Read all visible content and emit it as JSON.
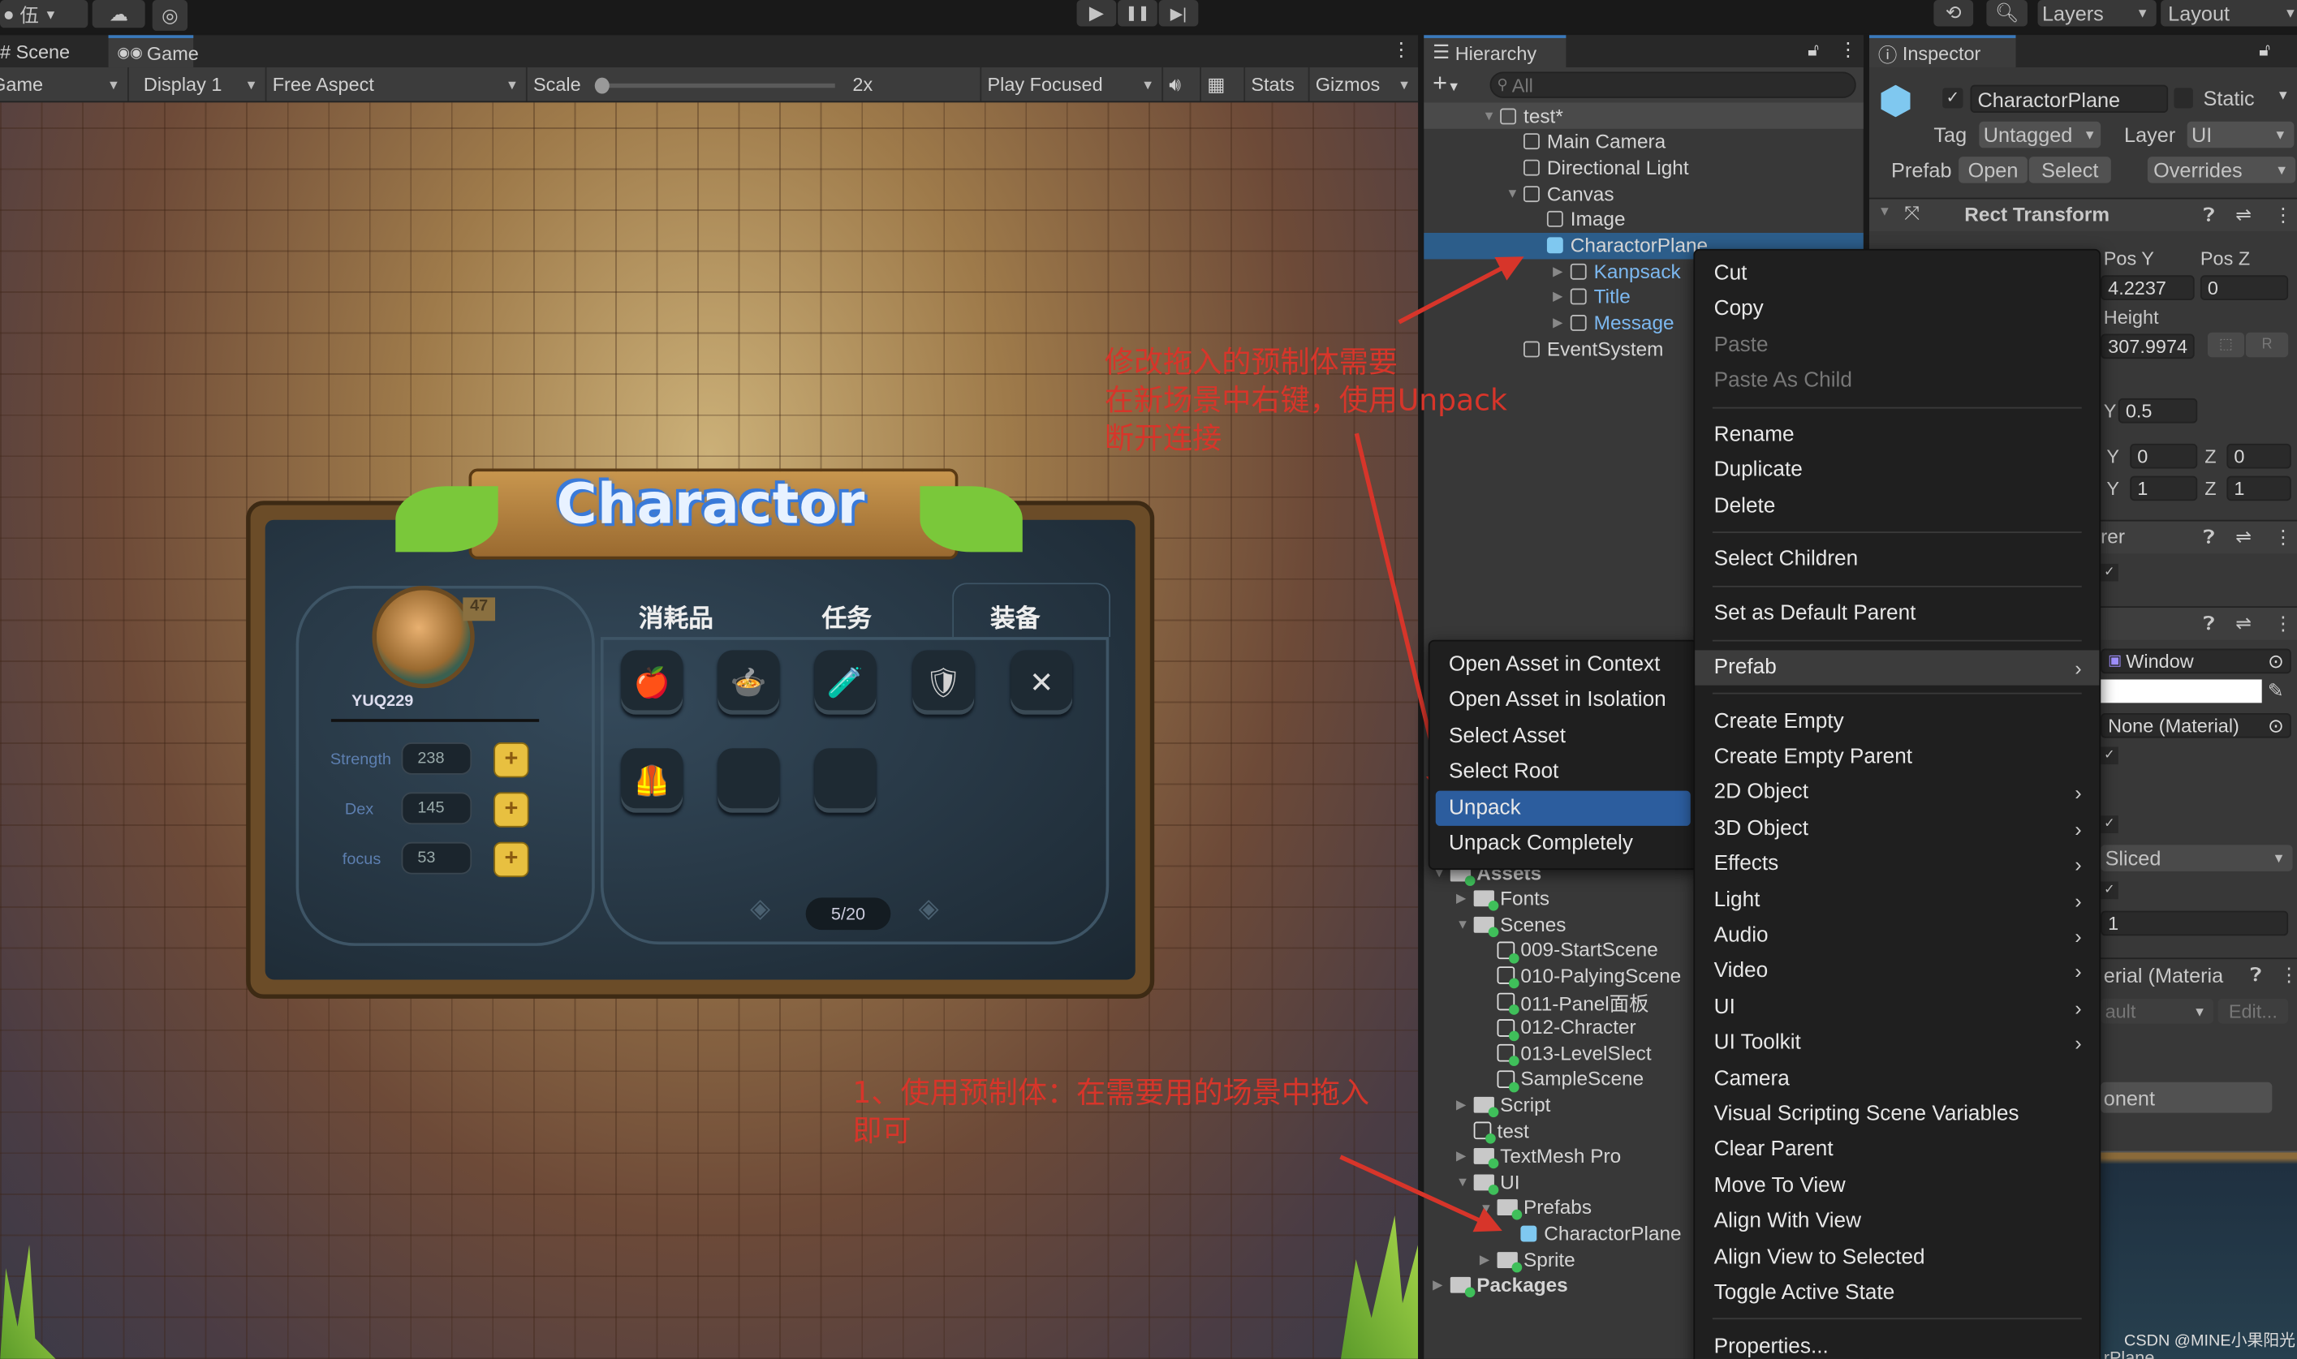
{
  "toolbar": {
    "account": "伍",
    "play": "▶",
    "pause": "❚❚",
    "step": "▶|",
    "layers": "Layers",
    "layout": "Layout"
  },
  "game_panel": {
    "tabs": [
      "Scene",
      "Game"
    ],
    "active_tab": "Game",
    "controls": {
      "mode": "Game",
      "display": "Display 1",
      "aspect": "Free Aspect",
      "scale_label": "Scale",
      "scale_value": "2x",
      "scale_fraction": 0.0,
      "play_mode": "Play Focused",
      "stats": "Stats",
      "gizmos": "Gizmos"
    }
  },
  "game_ui": {
    "title": "Charactor",
    "player_name": "YUQ229",
    "level": "47",
    "stats": [
      {
        "label": "Strength",
        "value": "238"
      },
      {
        "label": "Dex",
        "value": "145"
      },
      {
        "label": "focus",
        "value": "53"
      }
    ],
    "tabs": [
      "消耗品",
      "任务",
      "装备"
    ],
    "active_tab": "装备",
    "items": [
      "🍎",
      "🍲",
      "🧪",
      "🛡",
      "✕",
      "🦺",
      "",
      ""
    ],
    "page": "5/20"
  },
  "hierarchy": {
    "tab": "Hierarchy",
    "search_placeholder": "All",
    "items": [
      {
        "label": "test*",
        "depth": 0,
        "expanded": true
      },
      {
        "label": "Main Camera",
        "depth": 1
      },
      {
        "label": "Directional Light",
        "depth": 1
      },
      {
        "label": "Canvas",
        "depth": 1,
        "expanded": true
      },
      {
        "label": "Image",
        "depth": 2
      },
      {
        "label": "CharactorPlane",
        "depth": 2,
        "selected": true,
        "prefab": true
      },
      {
        "label": "Kanpsack",
        "depth": 3,
        "prefab_child": true
      },
      {
        "label": "Title",
        "depth": 3,
        "prefab_child": true
      },
      {
        "label": "Message",
        "depth": 3,
        "prefab_child": true
      },
      {
        "label": "EventSystem",
        "depth": 1
      }
    ]
  },
  "project": {
    "items": [
      {
        "label": "Assets",
        "type": "folder",
        "depth": 0
      },
      {
        "label": "Fonts",
        "type": "folder",
        "depth": 1
      },
      {
        "label": "Scenes",
        "type": "folder",
        "depth": 1
      },
      {
        "label": "009-StartScene",
        "type": "scene",
        "depth": 2
      },
      {
        "label": "010-PalyingScene",
        "type": "scene",
        "depth": 2
      },
      {
        "label": "011-Panel面板",
        "type": "scene",
        "depth": 2
      },
      {
        "label": "012-Chracter",
        "type": "scene",
        "depth": 2
      },
      {
        "label": "013-LevelSlect",
        "type": "scene",
        "depth": 2
      },
      {
        "label": "SampleScene",
        "type": "scene",
        "depth": 2
      },
      {
        "label": "Script",
        "type": "folder",
        "depth": 1
      },
      {
        "label": "test",
        "type": "scene",
        "depth": 1
      },
      {
        "label": "TextMesh Pro",
        "type": "folder",
        "depth": 1
      },
      {
        "label": "UI",
        "type": "folder",
        "depth": 1
      },
      {
        "label": "Prefabs",
        "type": "folder",
        "depth": 2
      },
      {
        "label": "CharactorPlane",
        "type": "prefab",
        "depth": 3
      },
      {
        "label": "Sprite",
        "type": "folder",
        "depth": 2
      },
      {
        "label": "Packages",
        "type": "folder",
        "depth": 0
      }
    ]
  },
  "inspector": {
    "tab": "Inspector",
    "object_name": "CharactorPlane",
    "active": true,
    "static_label": "Static",
    "tag_label": "Tag",
    "tag": "Untagged",
    "layer_label": "Layer",
    "layer": "UI",
    "prefab_label": "Prefab",
    "open": "Open",
    "select": "Select",
    "overrides": "Overrides",
    "rect_transform": "Rect Transform",
    "pos_y_label": "Pos Y",
    "pos_z_label": "Pos Z",
    "pos_y": "4.2237",
    "pos_z": "0",
    "height_label": "Height",
    "height": "307.9974",
    "r_label": "R",
    "pivot_y_label": "Y",
    "pivot_y": "0.5",
    "rot_y_label": "Y",
    "rot_y": "0",
    "rot_z_label": "Z",
    "rot_z": "0",
    "scale_y_label": "Y",
    "scale_y": "1",
    "scale_z_label": "Z",
    "scale_z": "1",
    "renderer_fragment": "rer",
    "source_image": "Window",
    "material": "None (Material)",
    "image_type": "Sliced",
    "pixels_per_unit": "1",
    "material_section": "erial (Materia",
    "shader": "ault",
    "edit": "Edit...",
    "add_component": "onent",
    "preview_label": "rPlane"
  },
  "context_menu": {
    "items": [
      {
        "label": "Cut"
      },
      {
        "label": "Copy"
      },
      {
        "label": "Paste",
        "disabled": true
      },
      {
        "label": "Paste As Child",
        "disabled": true
      },
      {
        "sep": true
      },
      {
        "label": "Rename"
      },
      {
        "label": "Duplicate"
      },
      {
        "label": "Delete"
      },
      {
        "sep": true
      },
      {
        "label": "Select Children"
      },
      {
        "sep": true
      },
      {
        "label": "Set as Default Parent"
      },
      {
        "sep": true
      },
      {
        "label": "Prefab",
        "submenu": true,
        "highlighted": true
      },
      {
        "sep": true
      },
      {
        "label": "Create Empty"
      },
      {
        "label": "Create Empty Parent"
      },
      {
        "label": "2D Object",
        "submenu": true
      },
      {
        "label": "3D Object",
        "submenu": true
      },
      {
        "label": "Effects",
        "submenu": true
      },
      {
        "label": "Light",
        "submenu": true
      },
      {
        "label": "Audio",
        "submenu": true
      },
      {
        "label": "Video",
        "submenu": true
      },
      {
        "label": "UI",
        "submenu": true
      },
      {
        "label": "UI Toolkit",
        "submenu": true
      },
      {
        "label": "Camera"
      },
      {
        "label": "Visual Scripting Scene Variables"
      },
      {
        "label": "Clear Parent"
      },
      {
        "label": "Move To View"
      },
      {
        "label": "Align With View"
      },
      {
        "label": "Align View to Selected"
      },
      {
        "label": "Toggle Active State"
      },
      {
        "sep": true
      },
      {
        "label": "Properties..."
      }
    ]
  },
  "prefab_submenu": {
    "items": [
      {
        "label": "Open Asset in Context"
      },
      {
        "label": "Open Asset in Isolation"
      },
      {
        "label": "Select Asset"
      },
      {
        "label": "Select Root"
      },
      {
        "label": "Unpack",
        "selected": true
      },
      {
        "label": "Unpack Completely"
      }
    ]
  },
  "annotations": {
    "note1": [
      "修改拖入的预制体需要",
      "在新场景中右键，使用Unpack",
      "断开连接"
    ],
    "note2": [
      "1、使用预制体：在需要用的场景中拖入",
      "即可"
    ],
    "color": "#d7352a"
  },
  "watermark": "CSDN @MINE小果阳光"
}
